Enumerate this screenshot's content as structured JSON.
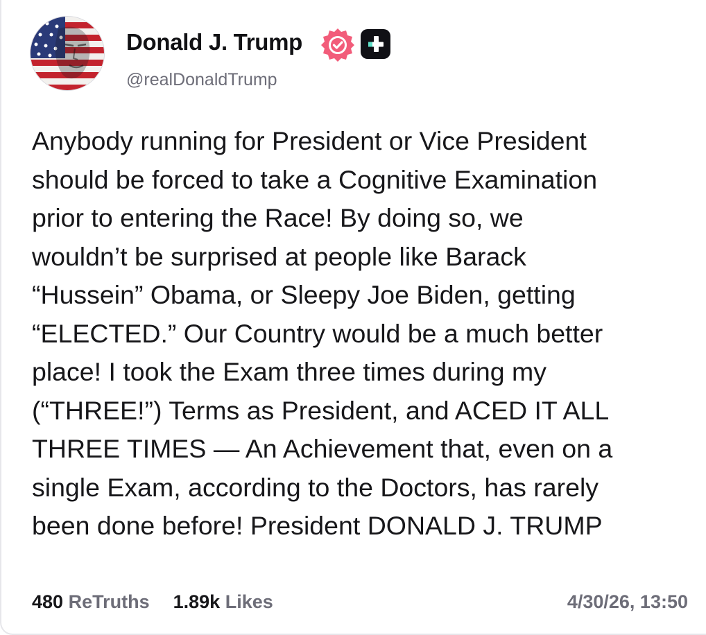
{
  "profile": {
    "display_name": "Donald J. Trump",
    "handle": "@realDonaldTrump",
    "avatar_icon": "flag-portrait-avatar",
    "verified_icon": "verified-badge-icon",
    "plus_icon": "truth-plus-icon"
  },
  "post": {
    "text": "Anybody running for President or Vice President\nshould be forced to take a Cognitive Examination\nprior to entering the Race! By doing so, we\nwouldn’t be surprised at people like Barack\n“Hussein” Obama, or Sleepy Joe Biden, getting\n“ELECTED.” Our Country would be a much better\nplace! I took the Exam three times during my\n(“THREE!”) Terms as President, and ACED IT ALL\nTHREE TIMES — An Achievement that, even on a\nsingle Exam, according to the Doctors, has rarely\nbeen done before! President DONALD J. TRUMP"
  },
  "stats": {
    "retruths_count": "480",
    "retruths_label": "ReTruths",
    "likes_count": "1.89k",
    "likes_label": "Likes",
    "timestamp": "4/30/26, 13:50"
  },
  "colors": {
    "verified_badge": "#f25c7a",
    "text_primary": "#17171a",
    "text_secondary": "#6d6d78",
    "plus_badge": "#101015"
  }
}
